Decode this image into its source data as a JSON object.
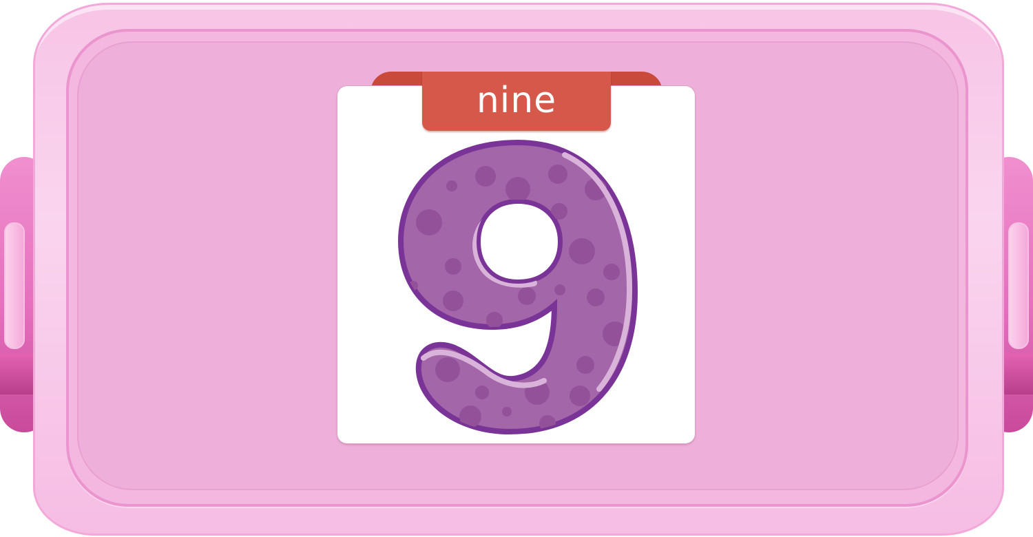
{
  "card": {
    "word": "nine",
    "numeral": "9"
  },
  "colors": {
    "lid": "#eeb0da",
    "lid_rim": "#f3b7e0",
    "handle": "#e56fbd",
    "tab": "#d6584a",
    "digit_fill": "#a366a8",
    "digit_outline": "#7a3497",
    "digit_spots": "#93519a"
  },
  "icons": {
    "digit": "number-nine-icon"
  }
}
